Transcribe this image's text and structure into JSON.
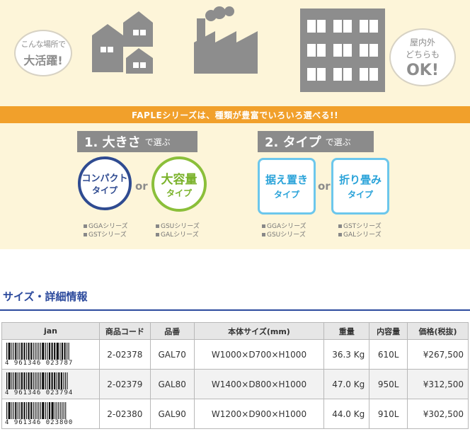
{
  "banner": {
    "bubble_left_line1": "こんな場所で",
    "bubble_left_line2": "大活躍!",
    "bubble_right_line1": "屋内外",
    "bubble_right_line2": "どちらも",
    "bubble_right_line3": "OK!",
    "orange_bar": "FAPLEシリーズは、種類が豊富でいろいろ選べる!!",
    "select_size_num": "1. 大きさ",
    "select_size_sub": "で選ぶ",
    "select_type_num": "2. タイプ",
    "select_type_sub": "で選ぶ",
    "compact_line1": "コンパクト",
    "compact_line2": "タイプ",
    "large_line1": "大容量",
    "large_line2": "タイプ",
    "or_label": "or",
    "sueoki_line1": "据え置き",
    "sueoki_line2": "タイプ",
    "oritatami_line1": "折り畳み",
    "oritatami_line2": "タイプ",
    "series_compact": [
      "GGAシリーズ",
      "GSTシリーズ"
    ],
    "series_large": [
      "GSUシリーズ",
      "GALシリーズ"
    ],
    "series_sueoki": [
      "GGAシリーズ",
      "GSUシリーズ"
    ],
    "series_oritatami": [
      "GSTシリーズ",
      "GALシリーズ"
    ],
    "colors": {
      "banner_bg": "#fdf5d9",
      "orange": "#f1a02b",
      "navy": "#2f4b91",
      "green": "#8bbf3a",
      "sky": "#6cc7ec",
      "building": "#8d8d8d"
    }
  },
  "section": {
    "title": "サイズ・詳細情報"
  },
  "table": {
    "headers": [
      "jan",
      "商品コード",
      "品番",
      "本体サイズ(mm)",
      "重量",
      "内容量",
      "価格(税抜)"
    ],
    "rows": [
      {
        "jan": "4961346023787",
        "jan_text": "4 961346 023787",
        "code": "2-02378",
        "part": "GAL70",
        "size": "W1000×D700×H1000",
        "weight": "36.3 Kg",
        "capacity": "610L",
        "price": "¥267,500"
      },
      {
        "jan": "4961346023794",
        "jan_text": "4 961346 023794",
        "code": "2-02379",
        "part": "GAL80",
        "size": "W1400×D800×H1000",
        "weight": "47.0 Kg",
        "capacity": "950L",
        "price": "¥312,500"
      },
      {
        "jan": "4961346023800",
        "jan_text": "4 961346 023800",
        "code": "2-02380",
        "part": "GAL90",
        "size": "W1200×D900×H1000",
        "weight": "44.0 Kg",
        "capacity": "910L",
        "price": "¥302,500"
      }
    ]
  }
}
